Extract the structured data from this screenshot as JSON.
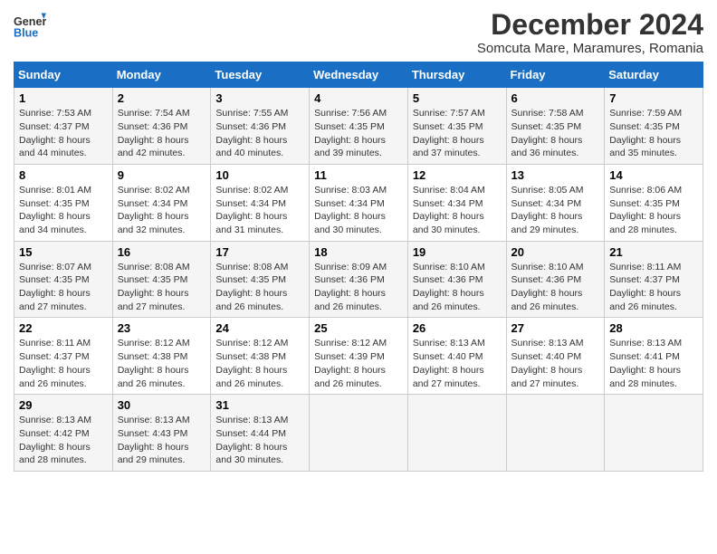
{
  "logo": {
    "line1": "General",
    "line2": "Blue"
  },
  "title": "December 2024",
  "subtitle": "Somcuta Mare, Maramures, Romania",
  "weekdays": [
    "Sunday",
    "Monday",
    "Tuesday",
    "Wednesday",
    "Thursday",
    "Friday",
    "Saturday"
  ],
  "weeks": [
    [
      {
        "day": "1",
        "sunrise": "7:53 AM",
        "sunset": "4:37 PM",
        "daylight": "8 hours and 44 minutes."
      },
      {
        "day": "2",
        "sunrise": "7:54 AM",
        "sunset": "4:36 PM",
        "daylight": "8 hours and 42 minutes."
      },
      {
        "day": "3",
        "sunrise": "7:55 AM",
        "sunset": "4:36 PM",
        "daylight": "8 hours and 40 minutes."
      },
      {
        "day": "4",
        "sunrise": "7:56 AM",
        "sunset": "4:35 PM",
        "daylight": "8 hours and 39 minutes."
      },
      {
        "day": "5",
        "sunrise": "7:57 AM",
        "sunset": "4:35 PM",
        "daylight": "8 hours and 37 minutes."
      },
      {
        "day": "6",
        "sunrise": "7:58 AM",
        "sunset": "4:35 PM",
        "daylight": "8 hours and 36 minutes."
      },
      {
        "day": "7",
        "sunrise": "7:59 AM",
        "sunset": "4:35 PM",
        "daylight": "8 hours and 35 minutes."
      }
    ],
    [
      {
        "day": "8",
        "sunrise": "8:01 AM",
        "sunset": "4:35 PM",
        "daylight": "8 hours and 34 minutes."
      },
      {
        "day": "9",
        "sunrise": "8:02 AM",
        "sunset": "4:34 PM",
        "daylight": "8 hours and 32 minutes."
      },
      {
        "day": "10",
        "sunrise": "8:02 AM",
        "sunset": "4:34 PM",
        "daylight": "8 hours and 31 minutes."
      },
      {
        "day": "11",
        "sunrise": "8:03 AM",
        "sunset": "4:34 PM",
        "daylight": "8 hours and 30 minutes."
      },
      {
        "day": "12",
        "sunrise": "8:04 AM",
        "sunset": "4:34 PM",
        "daylight": "8 hours and 30 minutes."
      },
      {
        "day": "13",
        "sunrise": "8:05 AM",
        "sunset": "4:34 PM",
        "daylight": "8 hours and 29 minutes."
      },
      {
        "day": "14",
        "sunrise": "8:06 AM",
        "sunset": "4:35 PM",
        "daylight": "8 hours and 28 minutes."
      }
    ],
    [
      {
        "day": "15",
        "sunrise": "8:07 AM",
        "sunset": "4:35 PM",
        "daylight": "8 hours and 27 minutes."
      },
      {
        "day": "16",
        "sunrise": "8:08 AM",
        "sunset": "4:35 PM",
        "daylight": "8 hours and 27 minutes."
      },
      {
        "day": "17",
        "sunrise": "8:08 AM",
        "sunset": "4:35 PM",
        "daylight": "8 hours and 26 minutes."
      },
      {
        "day": "18",
        "sunrise": "8:09 AM",
        "sunset": "4:36 PM",
        "daylight": "8 hours and 26 minutes."
      },
      {
        "day": "19",
        "sunrise": "8:10 AM",
        "sunset": "4:36 PM",
        "daylight": "8 hours and 26 minutes."
      },
      {
        "day": "20",
        "sunrise": "8:10 AM",
        "sunset": "4:36 PM",
        "daylight": "8 hours and 26 minutes."
      },
      {
        "day": "21",
        "sunrise": "8:11 AM",
        "sunset": "4:37 PM",
        "daylight": "8 hours and 26 minutes."
      }
    ],
    [
      {
        "day": "22",
        "sunrise": "8:11 AM",
        "sunset": "4:37 PM",
        "daylight": "8 hours and 26 minutes."
      },
      {
        "day": "23",
        "sunrise": "8:12 AM",
        "sunset": "4:38 PM",
        "daylight": "8 hours and 26 minutes."
      },
      {
        "day": "24",
        "sunrise": "8:12 AM",
        "sunset": "4:38 PM",
        "daylight": "8 hours and 26 minutes."
      },
      {
        "day": "25",
        "sunrise": "8:12 AM",
        "sunset": "4:39 PM",
        "daylight": "8 hours and 26 minutes."
      },
      {
        "day": "26",
        "sunrise": "8:13 AM",
        "sunset": "4:40 PM",
        "daylight": "8 hours and 27 minutes."
      },
      {
        "day": "27",
        "sunrise": "8:13 AM",
        "sunset": "4:40 PM",
        "daylight": "8 hours and 27 minutes."
      },
      {
        "day": "28",
        "sunrise": "8:13 AM",
        "sunset": "4:41 PM",
        "daylight": "8 hours and 28 minutes."
      }
    ],
    [
      {
        "day": "29",
        "sunrise": "8:13 AM",
        "sunset": "4:42 PM",
        "daylight": "8 hours and 28 minutes."
      },
      {
        "day": "30",
        "sunrise": "8:13 AM",
        "sunset": "4:43 PM",
        "daylight": "8 hours and 29 minutes."
      },
      {
        "day": "31",
        "sunrise": "8:13 AM",
        "sunset": "4:44 PM",
        "daylight": "8 hours and 30 minutes."
      },
      null,
      null,
      null,
      null
    ]
  ],
  "labels": {
    "sunrise": "Sunrise:",
    "sunset": "Sunset:",
    "daylight": "Daylight:"
  }
}
